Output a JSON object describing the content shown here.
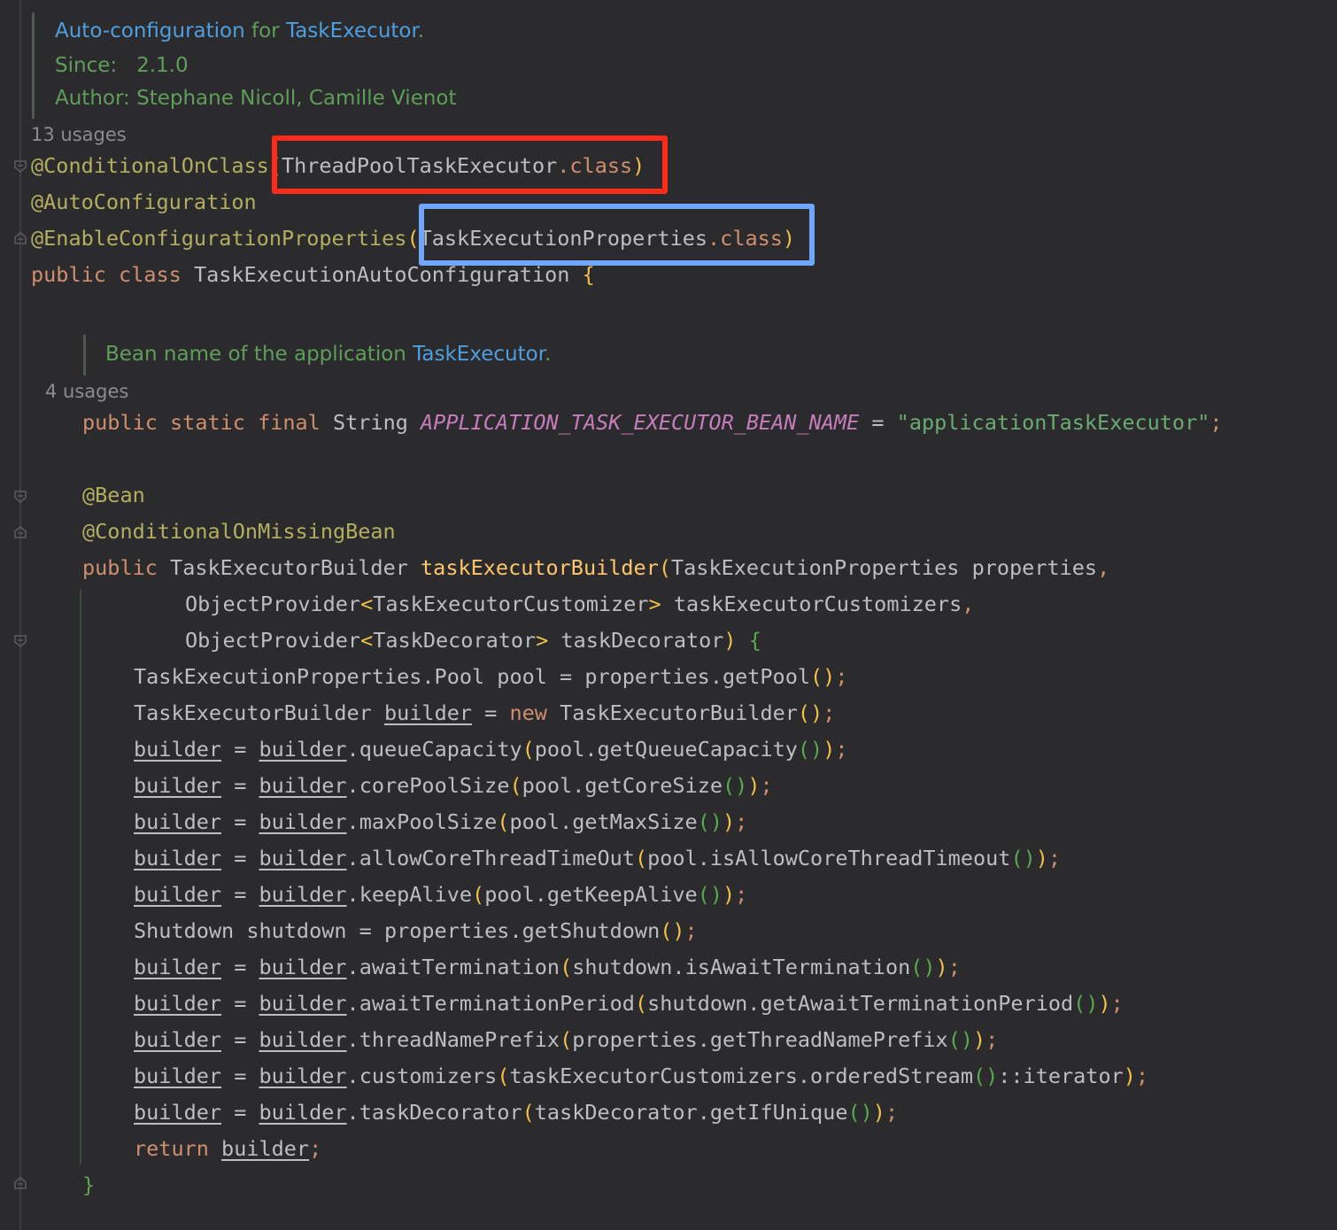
{
  "doc_comment": {
    "summary_link": "Auto-configuration",
    "summary_mid": " for ",
    "summary_type": "TaskExecutor",
    "summary_end": ".",
    "since_label": "Since:",
    "since_value": "2.1.0",
    "author_label": "Author:",
    "author_value": "Stephane Nicoll, Camille Vienot"
  },
  "class_usages": "13 usages",
  "annotations": {
    "conditional_on_class": "@ConditionalOnClass",
    "conditional_arg_open": "(",
    "conditional_arg_type": "ThreadPoolTaskExecutor",
    "conditional_arg_class": ".class",
    "conditional_arg_close": ")",
    "auto_configuration": "@AutoConfiguration",
    "enable_props": "@EnableConfigurationProperties",
    "enable_arg_open": "(",
    "enable_arg_type": "TaskExecutionProperties",
    "enable_arg_class": ".class",
    "enable_arg_close": ")"
  },
  "class_decl": {
    "kw_public": "public",
    "kw_class": "class",
    "name": "TaskExecutionAutoConfiguration",
    "brace": "{"
  },
  "field_doc": {
    "text": "Bean name of the application ",
    "type": "TaskExecutor",
    "end": "."
  },
  "field_usages": "4 usages",
  "field": {
    "modifiers": "public static final",
    "type": "String",
    "name": "APPLICATION_TASK_EXECUTOR_BEAN_NAME",
    "eq": " = ",
    "value": "\"applicationTaskExecutor\"",
    "semi": ";"
  },
  "method": {
    "ann_bean": "@Bean",
    "ann_missing": "@ConditionalOnMissingBean",
    "kw_public": "public",
    "return_type": "TaskExecutorBuilder",
    "name": "taskExecutorBuilder",
    "param1_type": "TaskExecutionProperties",
    "param1_name": "properties",
    "param2_type_outer": "ObjectProvider",
    "param2_type_inner": "TaskExecutorCustomizer",
    "param2_name": "taskExecutorCustomizers",
    "param3_type_outer": "ObjectProvider",
    "param3_type_inner": "TaskDecorator",
    "param3_name": "taskDecorator",
    "open_brace": "{",
    "close_brace": "}"
  },
  "body": {
    "pool_decl": "TaskExecutionProperties.Pool pool = properties.getPool",
    "builder_type": "TaskExecutorBuilder",
    "builder_var": "builder",
    "kw_new": "new",
    "builder_ctor": "TaskExecutorBuilder",
    "assign": " = ",
    "calls": [
      {
        "method": ".queueCapacity",
        "arg": "pool.getQueueCapacity"
      },
      {
        "method": ".corePoolSize",
        "arg": "pool.getCoreSize"
      },
      {
        "method": ".maxPoolSize",
        "arg": "pool.getMaxSize"
      },
      {
        "method": ".allowCoreThreadTimeOut",
        "arg": "pool.isAllowCoreThreadTimeout"
      },
      {
        "method": ".keepAlive",
        "arg": "pool.getKeepAlive"
      }
    ],
    "shutdown_decl": "Shutdown shutdown = properties.getShutdown",
    "calls2": [
      {
        "method": ".awaitTermination",
        "arg": "shutdown.isAwaitTermination"
      },
      {
        "method": ".awaitTerminationPeriod",
        "arg": "shutdown.getAwaitTerminationPeriod"
      },
      {
        "method": ".threadNamePrefix",
        "arg": "properties.getThreadNamePrefix"
      },
      {
        "method": ".customizers",
        "arg": "taskExecutorCustomizers.orderedStream",
        "suffix": "::iterator"
      },
      {
        "method": ".taskDecorator",
        "arg": "taskDecorator.getIfUnique"
      }
    ],
    "kw_return": "return"
  },
  "highlight_colors": {
    "red_box": "#ff2a1a",
    "blue_box": "#6fa6ff"
  }
}
